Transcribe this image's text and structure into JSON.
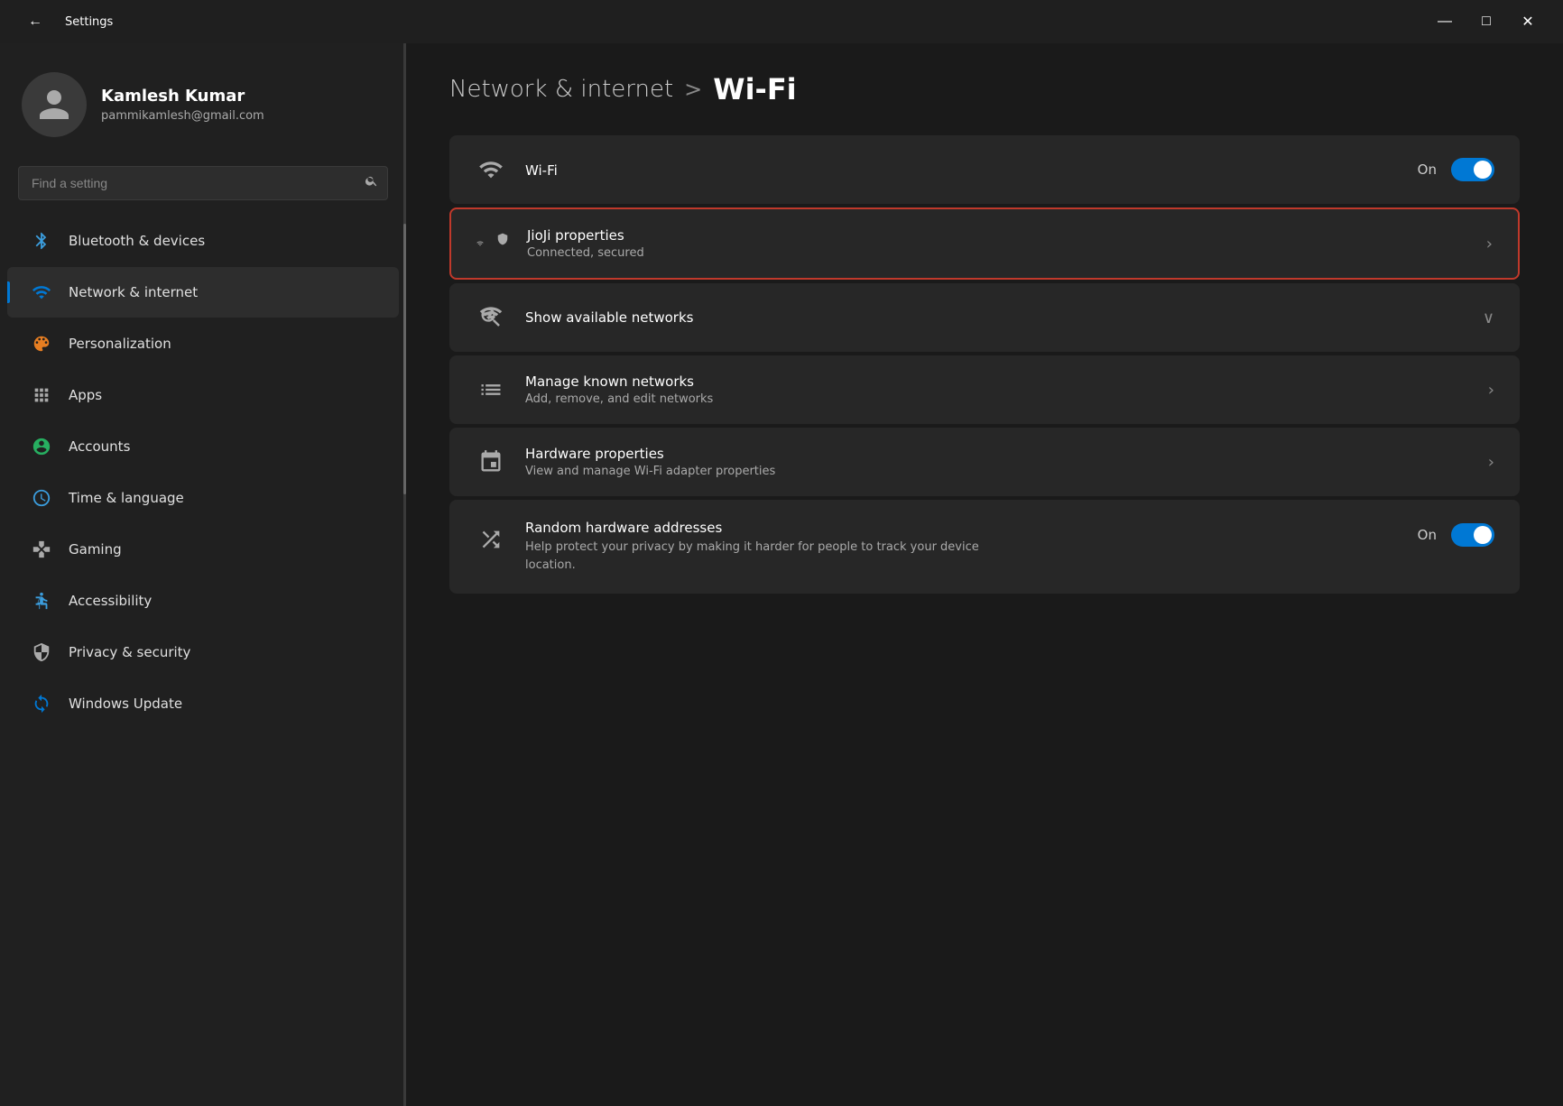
{
  "titleBar": {
    "back_label": "←",
    "title": "Settings",
    "minimize": "—",
    "maximize": "□",
    "close": "✕"
  },
  "sidebar": {
    "user": {
      "name": "Kamlesh Kumar",
      "email": "pammikamlesh@gmail.com"
    },
    "search": {
      "placeholder": "Find a setting"
    },
    "items": [
      {
        "id": "bluetooth",
        "label": "Bluetooth & devices",
        "icon": "bluetooth"
      },
      {
        "id": "network",
        "label": "Network & internet",
        "icon": "network",
        "active": true
      },
      {
        "id": "personalization",
        "label": "Personalization",
        "icon": "personalization"
      },
      {
        "id": "apps",
        "label": "Apps",
        "icon": "apps"
      },
      {
        "id": "accounts",
        "label": "Accounts",
        "icon": "accounts"
      },
      {
        "id": "time",
        "label": "Time & language",
        "icon": "time"
      },
      {
        "id": "gaming",
        "label": "Gaming",
        "icon": "gaming"
      },
      {
        "id": "accessibility",
        "label": "Accessibility",
        "icon": "accessibility"
      },
      {
        "id": "privacy",
        "label": "Privacy & security",
        "icon": "privacy"
      },
      {
        "id": "windows-update",
        "label": "Windows Update",
        "icon": "windows-update"
      }
    ]
  },
  "content": {
    "breadcrumb_parent": "Network & internet",
    "breadcrumb_sep": ">",
    "breadcrumb_current": "Wi-Fi",
    "cards": [
      {
        "id": "wifi-toggle",
        "type": "toggle",
        "icon": "wifi",
        "title": "Wi-Fi",
        "toggle_state": "on",
        "toggle_label": "On"
      },
      {
        "id": "jioji",
        "type": "chevron",
        "icon": "wifi-connected",
        "title": "JioJi properties",
        "subtitle": "Connected, secured",
        "highlighted": true
      },
      {
        "id": "show-networks",
        "type": "chevron-down",
        "icon": "wifi-search",
        "title": "Show available networks",
        "subtitle": ""
      },
      {
        "id": "manage-networks",
        "type": "chevron",
        "icon": "list",
        "title": "Manage known networks",
        "subtitle": "Add, remove, and edit networks"
      },
      {
        "id": "hardware-props",
        "type": "chevron",
        "icon": "hardware",
        "title": "Hardware properties",
        "subtitle": "View and manage Wi-Fi adapter properties"
      },
      {
        "id": "random-hw",
        "type": "toggle",
        "icon": "shuffle",
        "title": "Random hardware addresses",
        "subtitle": "Help protect your privacy by making it harder for people to track your device location.",
        "toggle_state": "on",
        "toggle_label": "On"
      }
    ]
  }
}
